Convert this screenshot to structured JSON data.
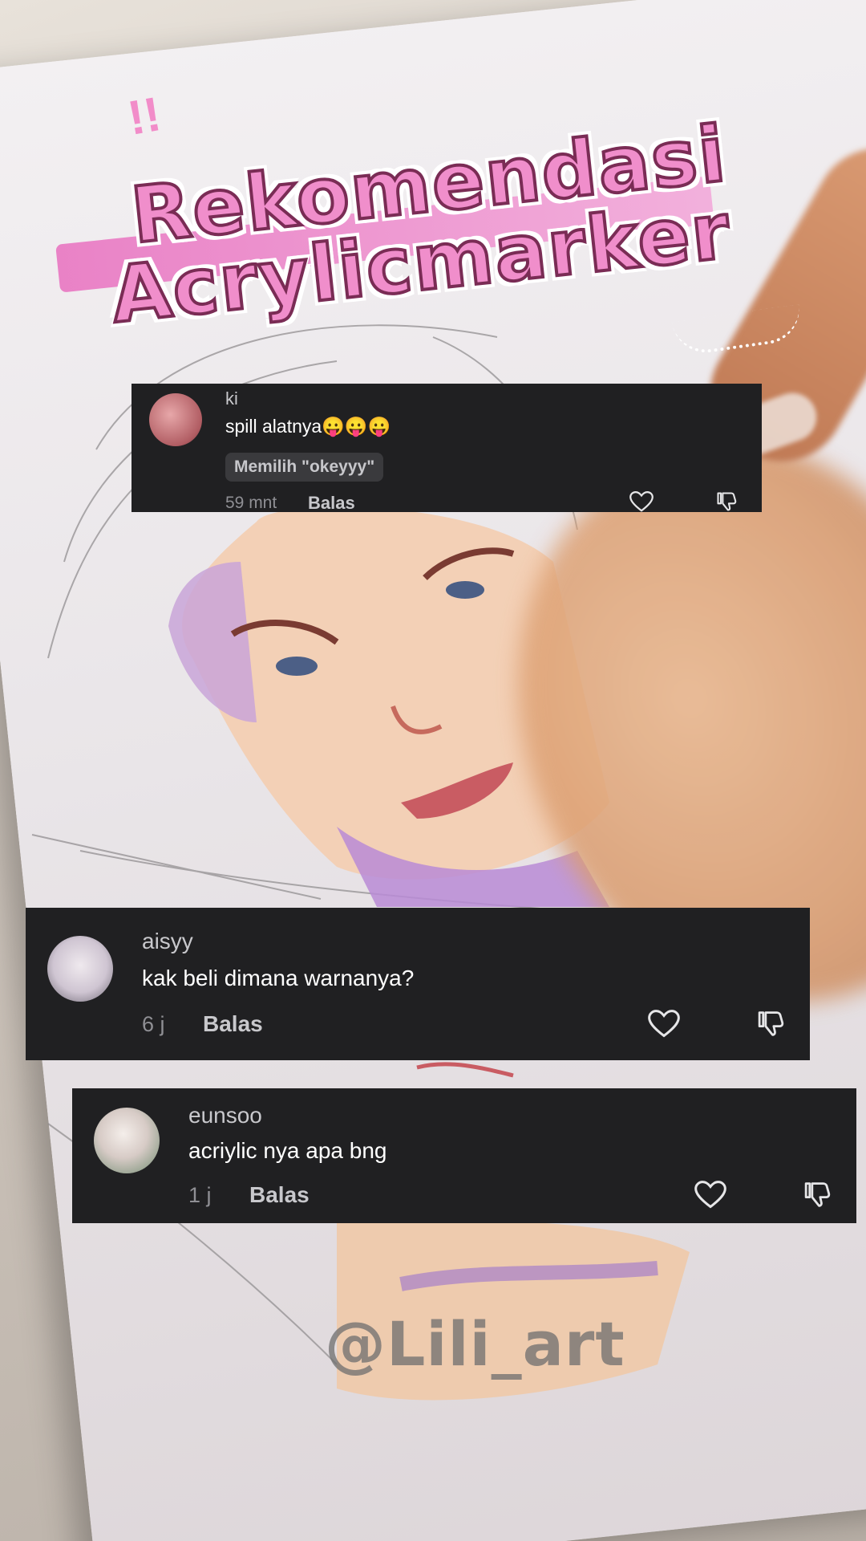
{
  "title": {
    "line1": "Rekomendasi",
    "line2": "Acrylicmarker"
  },
  "comments": [
    {
      "username": "ki",
      "text": "spill alatnya😛😛😛",
      "chip": "Memilih \"okeyyy\"",
      "time": "59 mnt",
      "reply_label": "Balas"
    },
    {
      "username": "aisyy",
      "text": "kak beli dimana warnanya?",
      "time": "6 j",
      "reply_label": "Balas"
    },
    {
      "username": "eunsoo",
      "text": "acriylic nya apa bng",
      "time": "1 j",
      "reply_label": "Balas"
    }
  ],
  "icons": {
    "like": "heart-outline-icon",
    "dislike": "thumbs-down-icon"
  },
  "watermark": "@Lili_art",
  "colors": {
    "card_bg": "#202022",
    "title_pink": "#f08ecb"
  }
}
